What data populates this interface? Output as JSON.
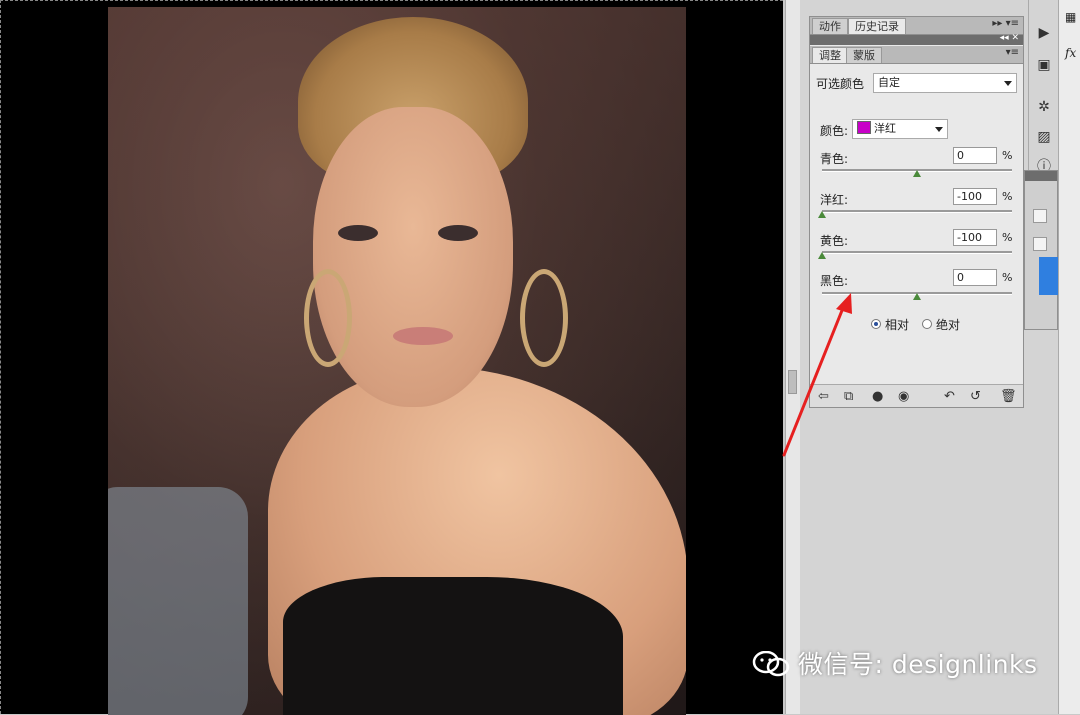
{
  "panel": {
    "top_tabs": [
      "动作",
      "历史记录"
    ],
    "adj_tabs": [
      "调整",
      "蒙版"
    ],
    "preset_label": "可选颜色",
    "preset_value": "自定",
    "color_label": "颜色:",
    "color_value": "洋红",
    "color_swatch": "#c800c8",
    "sliders": [
      {
        "label": "青色:",
        "value": "0",
        "unit": "%",
        "level": 0.5
      },
      {
        "label": "洋红:",
        "value": "-100",
        "unit": "%",
        "level": 0.0
      },
      {
        "label": "黄色:",
        "value": "-100",
        "unit": "%",
        "level": 0.0
      },
      {
        "label": "黑色:",
        "value": "0",
        "unit": "%",
        "level": 0.5
      }
    ],
    "method_relative": "相对",
    "method_absolute": "绝对",
    "method_selected": "相对"
  },
  "watermark": "微信号: designlinks",
  "colors": {
    "arrow": "#e62020",
    "slider_knob": "#4a8a3a"
  }
}
